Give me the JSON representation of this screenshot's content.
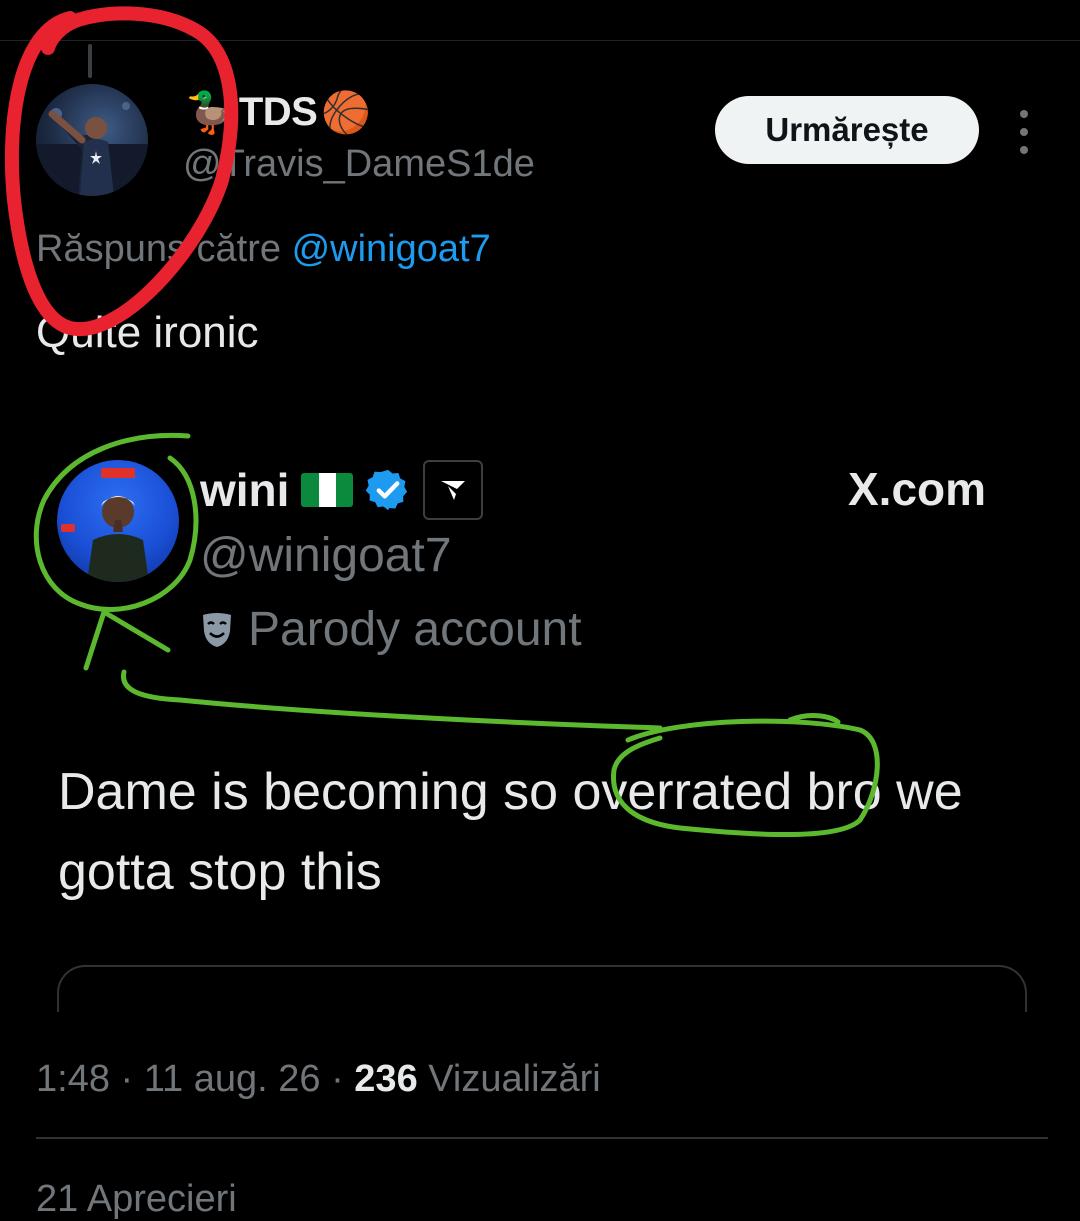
{
  "tweet": {
    "author": {
      "display_prefix_emoji": "🦆",
      "display_name": "TDS",
      "display_suffix_emoji": "🏀",
      "handle": "@Travis_DameS1de"
    },
    "follow_label": "Urmărește",
    "reply_prefix": "Răspuns către",
    "reply_mention": "@winigoat7",
    "text": "Quite ironic",
    "timestamp": "1:48 · 11 aug. 26 ·",
    "views_count": "236",
    "views_label": "Vizualizări",
    "reposts_partial": "21 Aprecieri"
  },
  "quoted": {
    "name": "wini",
    "flag_icon": "nigeria-flag-icon",
    "handle": "@winigoat7",
    "parody_label": "Parody account",
    "source": "X.com",
    "text": "Dame is becoming so overrated bro we gotta stop this"
  },
  "colors": {
    "background": "#000000",
    "text": "#e7e9ea",
    "muted": "#71767b",
    "link": "#1d9bf0",
    "annotation_red": "#e8232f",
    "annotation_green": "#5cb82e"
  }
}
